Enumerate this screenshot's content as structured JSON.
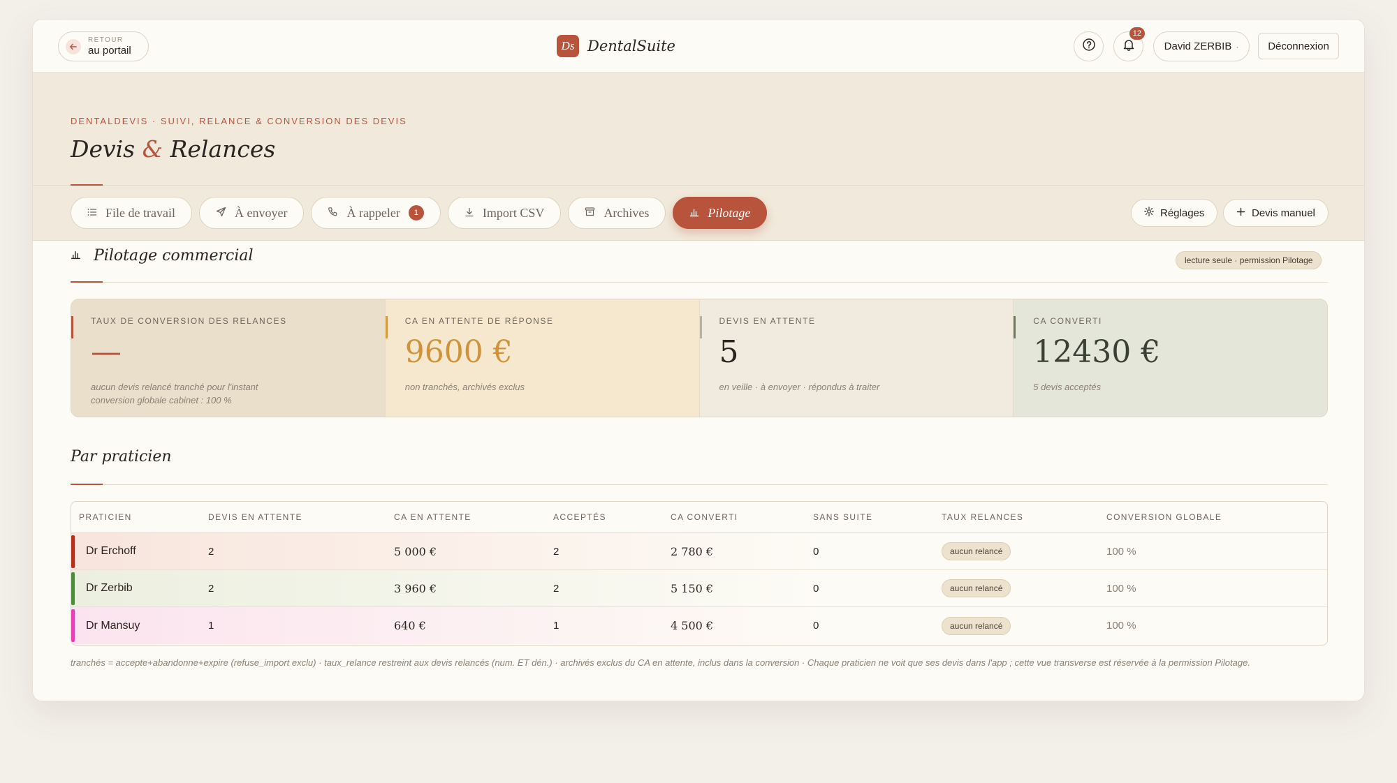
{
  "topbar": {
    "back_small": "RETOUR",
    "back_label": "au portail",
    "brand_logo": "Ds",
    "brand_name": "DentalSuite",
    "notif_count": "12",
    "user_label": "David ZERBIB",
    "user_caret": "·",
    "logout_label": "Déconnexion"
  },
  "header": {
    "eyebrow": "DENTALDEVIS · SUIVI, RELANCE & CONVERSION DES DEVIS",
    "title_a": "Devis",
    "title_amp": "&",
    "title_b": "Relances"
  },
  "tabs": [
    {
      "label": "File de travail",
      "icon": "list-icon"
    },
    {
      "label": "À envoyer",
      "icon": "send-icon"
    },
    {
      "label": "À rappeler",
      "icon": "phone-icon",
      "count": "1"
    },
    {
      "label": "Import CSV",
      "icon": "download-icon"
    },
    {
      "label": "Archives",
      "icon": "archive-icon"
    },
    {
      "label": "Pilotage",
      "icon": "bar-chart-icon",
      "active": true
    }
  ],
  "actions": {
    "settings_label": "Réglages",
    "manual_label": "Devis manuel"
  },
  "section": {
    "title": "Pilotage commercial",
    "badge": "lecture seule · permission Pilotage"
  },
  "kpis": [
    {
      "label": "TAUX DE CONVERSION DES RELANCES",
      "value": "—",
      "note1": "aucun devis relancé tranché pour l'instant",
      "note2": "conversion globale cabinet : 100 %",
      "bg": "#e9dfcb",
      "accent": "#b9543c",
      "value_color": "#b9543c"
    },
    {
      "label": "CA EN ATTENTE DE RÉPONSE",
      "value": "9600 €",
      "note1": "non tranchés, archivés exclus",
      "note2": "",
      "bg": "#f5e8cf",
      "accent": "#d59a3c",
      "value_color": "#cf933a"
    },
    {
      "label": "DEVIS EN ATTENTE",
      "value": "5",
      "note1": "en veille · à envoyer · répondus à traiter",
      "note2": "",
      "bg": "#f1ebdf",
      "accent": "#b9b1a4",
      "value_color": "#2b2420"
    },
    {
      "label": "CA CONVERTI",
      "value": "12430 €",
      "note1": "5 devis acceptés",
      "note2": "",
      "bg": "#e5e6da",
      "accent": "#6f7c5a",
      "value_color": "#3b4035"
    }
  ],
  "practitioners": {
    "title": "Par praticien",
    "columns": [
      "PRATICIEN",
      "DEVIS EN ATTENTE",
      "CA EN ATTENTE",
      "ACCEPTÉS",
      "CA CONVERTI",
      "SANS SUITE",
      "TAUX RELANCES",
      "CONVERSION GLOBALE"
    ],
    "rows": [
      {
        "name": "Dr Erchoff",
        "pending": "2",
        "ca_pending": "5 000 €",
        "accepted": "2",
        "ca_converted": "2 780 €",
        "no_follow": "0",
        "rate": "aucun relancé",
        "global": "100 %",
        "color": "#b42f1c",
        "tint": "#f8e5dd"
      },
      {
        "name": "Dr Zerbib",
        "pending": "2",
        "ca_pending": "3 960 €",
        "accepted": "2",
        "ca_converted": "5 150 €",
        "no_follow": "0",
        "rate": "aucun relancé",
        "global": "100 %",
        "color": "#4f8a3e",
        "tint": "#ecefe0"
      },
      {
        "name": "Dr Mansuy",
        "pending": "1",
        "ca_pending": "640 €",
        "accepted": "1",
        "ca_converted": "4 500 €",
        "no_follow": "0",
        "rate": "aucun relancé",
        "global": "100 %",
        "color": "#e640b4",
        "tint": "#fbe4ef"
      }
    ]
  },
  "footnote": "tranchés = accepte+abandonne+expire (refuse_import exclu) · taux_relance restreint aux devis relancés (num. ET dén.) · archivés exclus du CA en attente, inclus dans la conversion · Chaque praticien ne voit que ses devis dans l'app ; cette vue transverse est réservée à la permission Pilotage."
}
